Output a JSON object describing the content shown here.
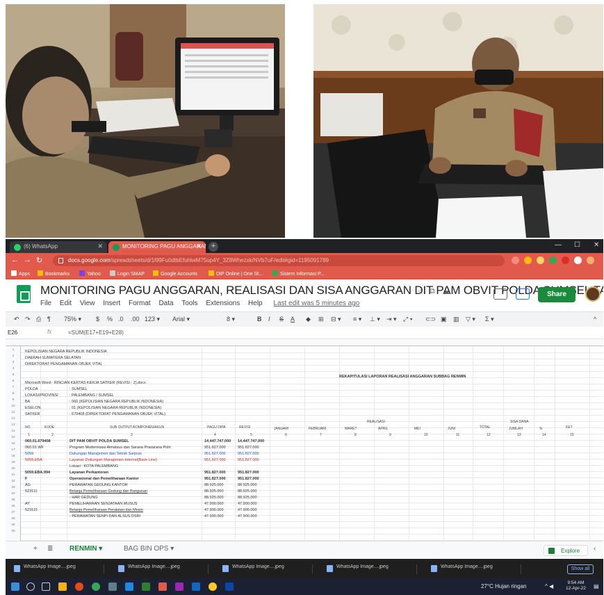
{
  "browser": {
    "tabs": [
      {
        "label": "(6) WhatsApp"
      },
      {
        "label": "MONITORING PAGU ANGGARAN, R"
      }
    ],
    "url_host": "docs.google.com",
    "url_path": "/spreadsheets/d/1l99Fu0dtbEfuhlwM75up4Y_3Z8Whezsk/NVb7uF/edit#gid=1195091789",
    "bookmarks": [
      "Apps",
      "Bookmarks",
      "Yahoo",
      "Login SMAP",
      "Google Accounts",
      "DIP Online | One St...",
      "Sistem Informasi P..."
    ]
  },
  "sheet": {
    "title": "MONITORING PAGU ANGGARAN, REALISASI DAN SISA ANGGARAN DIT PAM OBVIT POLDA SUMSEL TA...",
    "menu": [
      "File",
      "Edit",
      "View",
      "Insert",
      "Format",
      "Data",
      "Tools",
      "Extensions",
      "Help"
    ],
    "last_edit": "Last edit was 5 minutes ago",
    "share_label": "Share",
    "zoom": "75%",
    "font": "Arial",
    "font_size": "8",
    "name_box": "E26",
    "formula": "=SUM(E17+E19+E28)",
    "sheet_tabs": [
      "RENMIN",
      "BAG BIN OPS"
    ],
    "explore_label": "Explore"
  },
  "grid": {
    "header_lines": [
      "KEPOLISIAN NEGARA REPUBLIK INDONESIA",
      "DAERAH SUMATERA SELATAN",
      "DIREKTORAT PENGAMANAN OBJEK VITAL"
    ],
    "report_title": "REKAPITULASI LAPORAN REALISASI ANGGARAN SUBBAG RENMIN",
    "form_title": "Microsoft Word - RINCIAN KERTAS KERJA SATKER (REVISI - 2).docx",
    "info_rows": [
      {
        "key": "POLDA",
        "value": ": SUMSEL"
      },
      {
        "key": "LOKASI/PROVINSI",
        "value": ": PALEMBANG / SUMSEL"
      },
      {
        "key": "BA",
        "value": ": 060 (KEPOLISIAN NEGARA REPUBLIK INDONESIA)"
      },
      {
        "key": "ESELON",
        "value": ": 01 (KEPOLISIAN NEGARA REPUBLIK INDONESIA)"
      },
      {
        "key": "SATKER",
        "value": ": 679408 (DIREKTORAT PENGAMANAN OBJEK VITAL)"
      }
    ],
    "table_headers": [
      "NO",
      "KODE",
      "SUB OUTPUT/KOMPONEN/AKUN",
      "PAGU DIPA",
      "REVISI",
      "JANUARI",
      "FEBRUARI",
      "MARET",
      "APRIL",
      "MEI",
      "JUNI",
      "TOTAL",
      "JUMLAH",
      "%",
      "KET"
    ],
    "realisasi_label": "REALISASI",
    "sisa_label": "SISA DANA",
    "col_numbers": [
      "1",
      "2",
      "3",
      "4",
      "5",
      "6",
      "7",
      "8",
      "9",
      "10",
      "11",
      "12",
      "13",
      "14",
      "15"
    ],
    "rows": [
      {
        "code": "060.01.679408",
        "desc": "DIT PAM OBVIT POLDA SUMSEL",
        "pagu": "14.447.747.000",
        "revisi": "14.447.747.000",
        "style": "b"
      },
      {
        "code": "060.01.WF",
        "desc": "Program Modernisasi Almatsus dan Sarana Prasarana Polri",
        "pagu": "951.827.000",
        "revisi": "951.827.000",
        "style": ""
      },
      {
        "code": "5059",
        "desc": "Dukungan Manajemen dan Teknik Sarpras",
        "pagu": "951.827.000",
        "revisi": "951.827.000",
        "style": "blue"
      },
      {
        "code": "5059.EBA",
        "desc": "Layanan Dukungan Manajemen Internal(Base Line)",
        "pagu": "951.827.000",
        "revisi": "951.827.000",
        "style": "red"
      },
      {
        "code": "",
        "desc": "Lokasi : KOTA PALEMBANG",
        "pagu": "",
        "revisi": "",
        "style": ""
      },
      {
        "code": "5059.EBA.994",
        "desc": "Layanan Perkantoran",
        "pagu": "951.827.000",
        "revisi": "951.827.000",
        "style": "b"
      },
      {
        "code": "F",
        "desc": "Operasional dan Pemeliharaan Kantor",
        "pagu": "951.827.000",
        "revisi": "951.827.000",
        "style": "b"
      },
      {
        "code": "AG",
        "desc": "PERAWATAN GEDUNG KANTOR",
        "pagu": "88.925.000",
        "revisi": "88.925.000",
        "style": ""
      },
      {
        "code": "523111",
        "desc": "Belanja Pemeliharaan Gedung dan Bangunan",
        "pagu": "88.925.000",
        "revisi": "88.925.000",
        "style": "u"
      },
      {
        "code": "",
        "desc": "- HAR GEDUNG",
        "pagu": "88.925.000",
        "revisi": "88.925.000",
        "style": ""
      },
      {
        "code": "AY",
        "desc": "PEMELIHARAAN SENJATAAN MUSUS",
        "pagu": "47.900.000",
        "revisi": "47.900.000",
        "style": ""
      },
      {
        "code": "523121",
        "desc": "Belanja Pemeliharaan Peralatan dan Mesin",
        "pagu": "47.900.000",
        "revisi": "47.900.000",
        "style": "u"
      },
      {
        "code": "",
        "desc": "- PERAWATAN SENPI DAN ALSUS DSRI",
        "pagu": "47.900.000",
        "revisi": "47.900.000",
        "style": ""
      }
    ]
  },
  "downloads": [
    "WhatsApp Image....jpeg",
    "WhatsApp Image....jpeg",
    "WhatsApp Image....jpeg",
    "WhatsApp Image....jpeg",
    "WhatsApp Image....jpeg"
  ],
  "download_show_all": "Show all",
  "taskbar": {
    "weather": "27°C Hujan ringan",
    "time": "9:54 AM",
    "date": "12-Apr-22"
  }
}
